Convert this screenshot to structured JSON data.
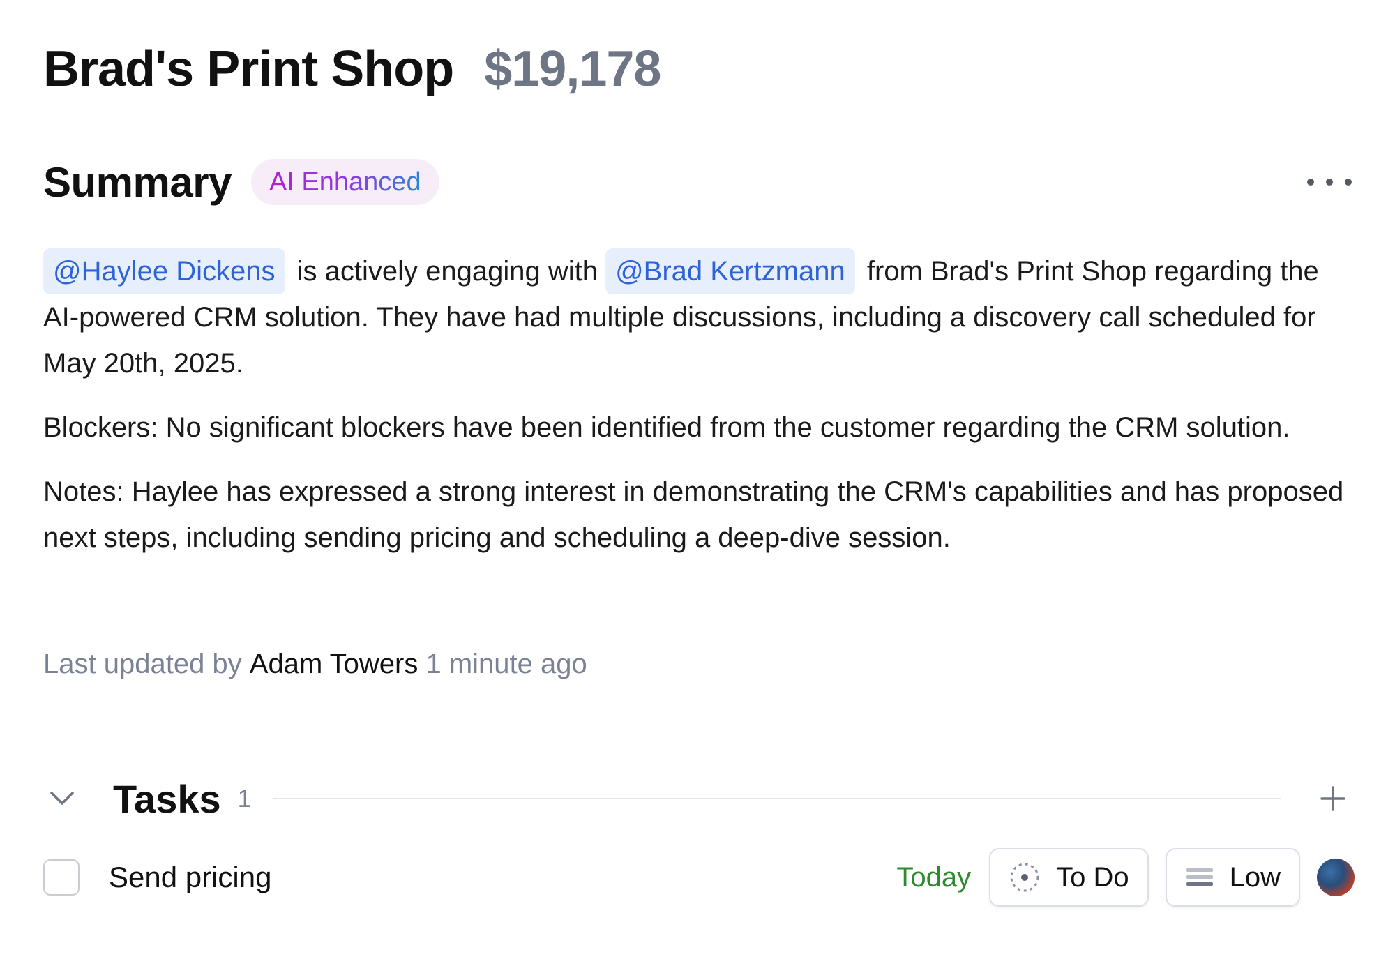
{
  "deal": {
    "title": "Brad's Print Shop",
    "amount": "$19,178"
  },
  "summary": {
    "title": "Summary",
    "badge": "AI Enhanced",
    "mention_1": "@Haylee Dickens",
    "text_1a": " is actively engaging with ",
    "mention_2": "@Brad Kertzmann",
    "text_1b": " from Brad's Print Shop regarding the AI-powered CRM solution. They have had multiple discussions, including a discovery call scheduled for May 20th, 2025.",
    "blockers": "Blockers: No significant blockers have been identified from the customer regarding the CRM solution.",
    "notes": "Notes: Haylee has expressed a strong interest in demonstrating the CRM's capabilities and has proposed next steps, including sending pricing and scheduling a deep-dive session.",
    "updated_prefix": "Last updated by ",
    "updated_author": "Adam Towers",
    "updated_suffix": " 1 minute ago"
  },
  "tasks": {
    "title": "Tasks",
    "count": "1",
    "items": [
      {
        "name": "Send pricing",
        "due": "Today",
        "status": "To Do",
        "priority": "Low"
      }
    ]
  },
  "colors": {
    "accent_blue": "#2c63d8",
    "due_green": "#2f8a2f",
    "muted": "#7a8294"
  }
}
